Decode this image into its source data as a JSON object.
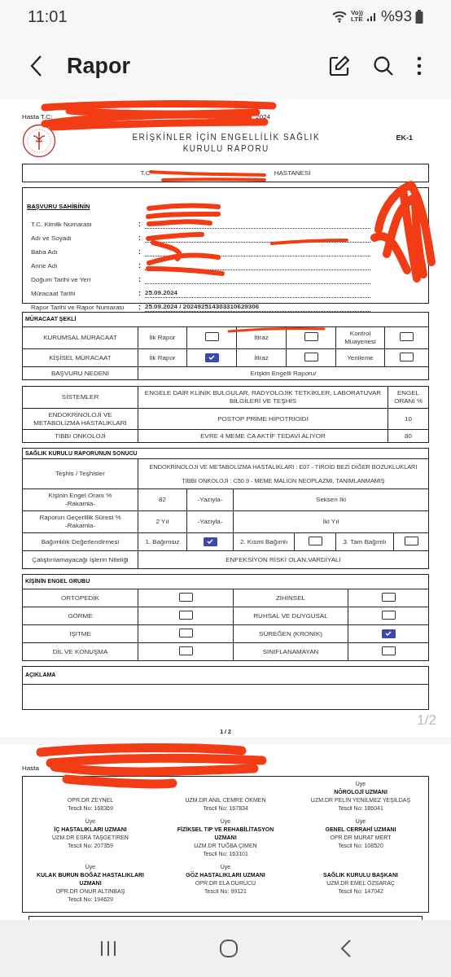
{
  "status_bar": {
    "time": "11:01",
    "volte_top": "Vo))",
    "volte_bottom": "LTE",
    "battery": "%93"
  },
  "app_bar": {
    "title": "Rapor"
  },
  "report_page": {
    "header_label": "Hasta T.C:",
    "header_year": "2024",
    "title_lines": [
      "ERİŞKİNLER İÇİN ENGELLİLİK SAĞLIK",
      "KURULU RAPORU"
    ],
    "form_code": "EK-1",
    "hospital": {
      "prefix": "T.C.",
      "suffix": "HASTANESİ"
    },
    "applicant": {
      "heading": "BAŞVURU SAHİBİNİN",
      "separator": ":",
      "fields": [
        {
          "label": "T.C. Kimlik Numarası"
        },
        {
          "label": "Adı ve Soyadı"
        },
        {
          "label": "Baba Adı"
        },
        {
          "label": "Anne Adı"
        },
        {
          "label": "Doğum Tarihi ve Yeri"
        },
        {
          "label": "Müracaat Tarihi",
          "value": "25.09.2024"
        },
        {
          "label": "Rapor Tarihi ve Rapor Numarası",
          "value": "25.09.2024 / 202492514303310629306"
        }
      ]
    },
    "application": {
      "heading": "MÜRACAAT ŞEKLİ",
      "rows": [
        {
          "label": "KURUMSAL MÜRACAAT",
          "options": [
            {
              "label": "İlk Rapor",
              "checked": false
            },
            {
              "label": "İtiraz",
              "checked": false
            },
            {
              "label": "Kontrol Muayenesi",
              "checked": false
            }
          ]
        },
        {
          "label": "KİŞİSEL MÜRACAAT",
          "options": [
            {
              "label": "İlk Rapor",
              "checked": true
            },
            {
              "label": "İtiraz",
              "checked": false
            },
            {
              "label": "Yenileme",
              "checked": false
            }
          ]
        }
      ],
      "reason": {
        "label": "BAŞVURU NEDENİ",
        "value": "Erişkin Engelli Raporu/"
      }
    },
    "systems": {
      "columns": [
        "SİSTEMLER",
        "ENGELE DAİR KLİNİK BULGULAR, RADYOLOJİK TETKİKLER, LABORATUVAR BİLGİLERİ VE TEŞHİS",
        "ENGEL ORANI %"
      ],
      "rows": [
        [
          "ENDOKRİNOLOJİ VE METABOLİZMA HASTALIKLARI",
          "POSTOP PRİME HİPOTRİOİDİ",
          "10"
        ],
        [
          "TIBBI ONKOLOJİ",
          "EVRE 4 MEME CA AKTİF TEDAVİ ALIYOR",
          "80"
        ]
      ]
    },
    "result": {
      "heading": "SAĞLIK KURULU RAPORUNUN SONUCU",
      "diagnoses": {
        "label": "Teşhis / Teşhisler",
        "lines": [
          "ENDOKRİNOLOJİ VE METABOLİZMA HASTALIKLARI : E07 - TİROİD BEZİ DİĞER BOZUKLUKLARI",
          "TIBBI ONKOLOJİ : C50.9 - MEME MALİGN NEOPLAZMI, TANIMLANMAMIŞ"
        ]
      },
      "numeric_rows": [
        {
          "label_lines": [
            "Kişinin Engel Oranı %",
            "-Rakamla-"
          ],
          "value": "82",
          "words_label": "-Yazıyla-",
          "words": "Seksen Iki"
        },
        {
          "label_lines": [
            "Raporun Geçerlilik Süresi %",
            "-Rakamla-"
          ],
          "value": "2 Yıl",
          "words_label": "-Yazıyla-",
          "words": "İki Yıl"
        }
      ],
      "dependency": {
        "label": "Bağımlılık Değerlendirmesi",
        "options": [
          {
            "label": "1. Bağımsız",
            "checked": true
          },
          {
            "label": "2. Kısmi Bağımlı",
            "checked": false
          },
          {
            "label": "3. Tam Bağımlı",
            "checked": false
          }
        ]
      },
      "restrictions": {
        "label": "Çalıştırılamayacağı İşlerin Niteliği",
        "value": "ENFEKSİYON RİSKİ OLAN,VARDİYALI"
      }
    },
    "disability_group": {
      "heading": "KİŞİNİN ENGEL GRUBU",
      "items": [
        {
          "label": "ORTOPEDİK",
          "checked": false
        },
        {
          "label": "ZİHİNSEL",
          "checked": false
        },
        {
          "label": "GÖRME",
          "checked": false
        },
        {
          "label": "RUHSAL VE DUYGUSAL",
          "checked": false
        },
        {
          "label": "İŞİTME",
          "checked": false
        },
        {
          "label": "SÜREĞEN (KRONİK)",
          "checked": true
        },
        {
          "label": "DİL VE KONUŞMA",
          "checked": false
        },
        {
          "label": "SINIFLANAMAYAN",
          "checked": false
        }
      ]
    },
    "explanation": {
      "heading": "AÇIKLAMA"
    },
    "page_number": "1 / 2"
  },
  "page_indicator": "1/2",
  "signature_page": {
    "header_label": "Hasta",
    "members": [
      {
        "name": "OPR.DR ZEYNEL",
        "registration": "Tescil No: 168369"
      },
      {
        "name": "UZM.DR ANIL CEMRE ÖKMEN",
        "registration": "Tescil No: 167834"
      },
      {
        "role": "Üye",
        "title": "NÖROLOJİ UZMANI",
        "name": "UZM.DR PELİN YENİLMEZ YEŞİLDAŞ",
        "registration": "Tescil No: 186041"
      },
      {
        "role": "Üye",
        "title": "İÇ HASTALIKLARI UZMANI",
        "name": "UZM.DR ESRA TAŞGETİREN",
        "registration": "Tescil No: 207359"
      },
      {
        "role": "Üye",
        "title": "FİZİKSEL TIP VE REHABİLİTASYON UZMANI",
        "name": "UZM.DR TUĞBA ÇİMEN",
        "registration": "Tescil No: 163101"
      },
      {
        "role": "Üye",
        "title": "GENEL CERRAHİ UZMANI",
        "name": "OPR.DR MURAT MERT",
        "registration": "Tescil No: 108520"
      },
      {
        "role": "Üye",
        "title": "KULAK BURUN BOĞAZ HASTALIKLARI UZMANI",
        "name": "OPR.DR ONUR ALTINBAŞ",
        "registration": "Tescil No: 194629"
      },
      {
        "role": "Üye",
        "title": "GÖZ HASTALIKLARI UZMANI",
        "name": "OPR.DR ELA DURUCU",
        "registration": "Tescil No: 99121"
      },
      {
        "title": "SAĞLIK KURULU BAŞKANI",
        "name": "UZM.DR EMEL ÖZSARAÇ",
        "registration": "Tescil No: 147042"
      }
    ]
  }
}
